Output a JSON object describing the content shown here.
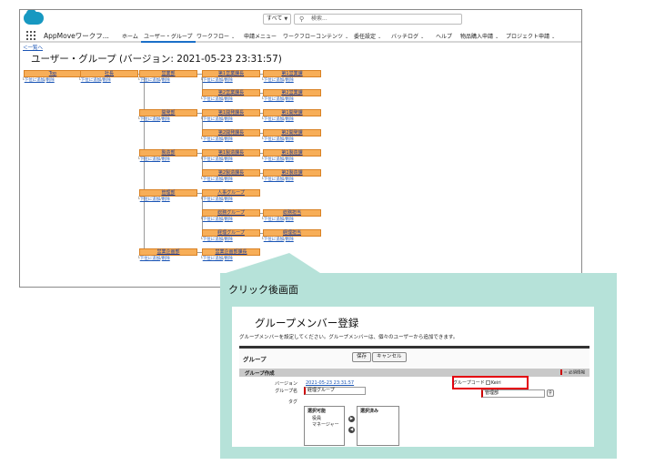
{
  "header": {
    "scope": "すべて",
    "search_placeholder": "検索..."
  },
  "nav": {
    "app_name": "AppMoveワークフ...",
    "items": [
      {
        "label": "ホーム",
        "dropdown": false
      },
      {
        "label": "ユーザー・グループ",
        "dropdown": false,
        "active": true
      },
      {
        "label": "ワークフロー",
        "dropdown": true
      },
      {
        "label": "申請メニュー",
        "dropdown": false
      },
      {
        "label": "ワークフローコンテンツ",
        "dropdown": true
      },
      {
        "label": "委任設定",
        "dropdown": true
      },
      {
        "label": "バッチログ",
        "dropdown": true
      },
      {
        "label": "ヘルプ",
        "dropdown": false
      },
      {
        "label": "物品購入申請",
        "dropdown": true
      },
      {
        "label": "プロジェクト申請",
        "dropdown": true
      }
    ]
  },
  "page": {
    "back_link": "＜一覧へ",
    "title": "ユーザー・グループ (バージョン: 2021-05-23 23:31:57)",
    "actions": {
      "add": "下位に追加",
      "delete": "削除",
      "separator": "/"
    }
  },
  "tree": {
    "top": "Top",
    "president": "社長",
    "divisions": [
      {
        "name": "営業部",
        "children": [
          {
            "name": "第1営業課長",
            "leaf": "第1営業課"
          },
          {
            "name": "第2営業課長",
            "leaf": "第2営業課"
          }
        ]
      },
      {
        "name": "開発部",
        "children": [
          {
            "name": "第1開発課長",
            "leaf": "第1開発課"
          },
          {
            "name": "第2開発課長",
            "leaf": "第2開発課"
          }
        ]
      },
      {
        "name": "製造部",
        "children": [
          {
            "name": "第1製造課長",
            "leaf": "第1製造課"
          },
          {
            "name": "第2製造課長",
            "leaf": "第2製造課"
          }
        ]
      },
      {
        "name": "管理部",
        "children": [
          {
            "name": "人事グループ",
            "leaf": null
          },
          {
            "name": "総務グループ",
            "leaf": "総務担当"
          },
          {
            "name": "経理グループ",
            "leaf": "経理担当"
          }
        ]
      },
      {
        "name": "営業企画部",
        "children": [
          {
            "name": "営業企画部課長",
            "leaf": null
          }
        ]
      }
    ]
  },
  "callout": {
    "label": "クリック後画面",
    "modal": {
      "title": "グループメンバー登録",
      "description": "グループメンバーを設定してください。グループメンバーは、個々のユーザーから追加できます。",
      "group_label": "グループ",
      "save_button": "保存",
      "cancel_button": "キャンセル",
      "section_title": "グループ作成",
      "required_note": "= 必須情報",
      "fields": {
        "version_label": "バージョン",
        "version_value": "2021-05-23 23:31:57",
        "group_name_label": "グループ名",
        "group_name_value": "経理グループ",
        "tag_label": "タグ",
        "group_code_label": "グループコード",
        "group_code_value": "Keiri",
        "parent_value": "管理部"
      },
      "available_header": "選択可能",
      "available_items": [
        "役員",
        "マネージャー"
      ],
      "selected_header": "選択済み",
      "highlight_color": "#e4000f"
    }
  },
  "colors": {
    "node_fill": "#f7ae58",
    "callout_bg": "#b6e2d9",
    "link": "#1b55b5"
  }
}
